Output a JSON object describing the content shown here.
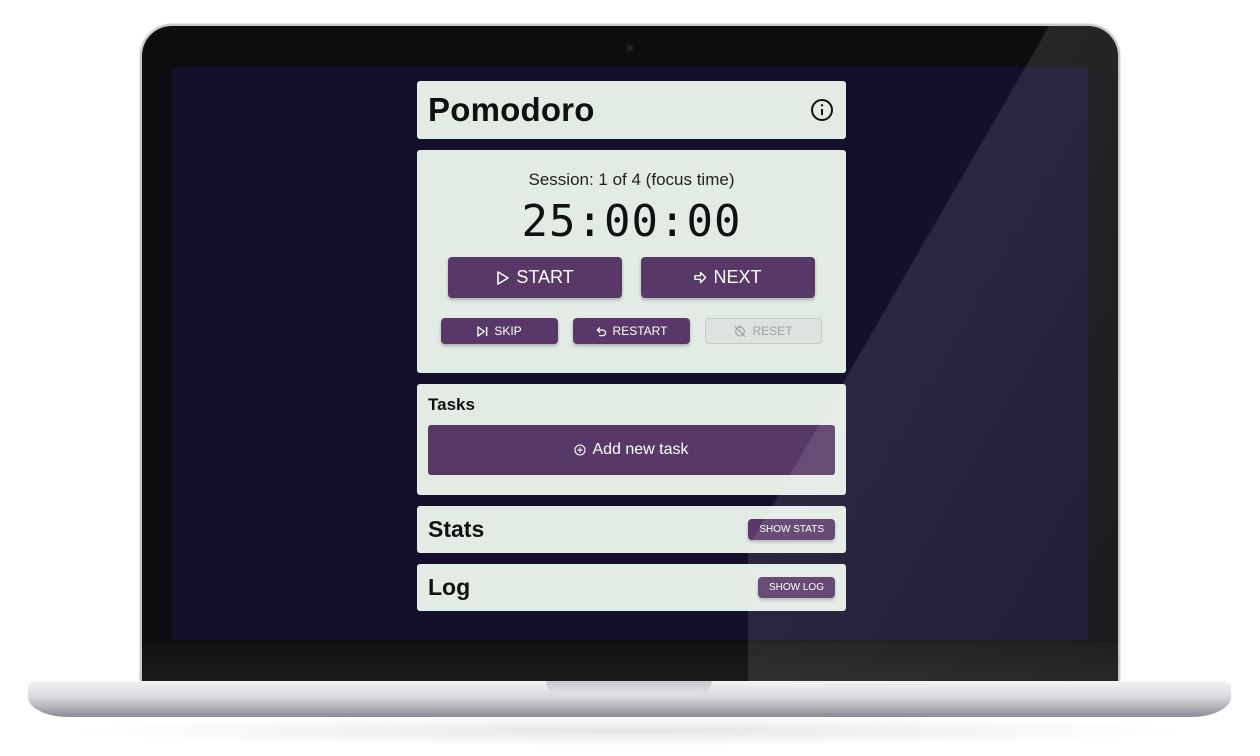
{
  "app": {
    "title": "Pomodoro",
    "info_icon": "info-icon"
  },
  "timer": {
    "session_text": "Session: 1 of 4 (focus time)",
    "clock": "25:00:00",
    "start_label": "START",
    "start_icon": "play-icon",
    "next_label": "NEXT",
    "next_icon": "arrow-right-icon",
    "skip_label": "SKIP",
    "skip_icon": "skip-icon",
    "restart_label": "RESTART",
    "restart_icon": "undo-icon",
    "reset_label": "RESET",
    "reset_icon": "timer-off-icon",
    "reset_disabled": true
  },
  "tasks": {
    "heading": "Tasks",
    "add_label": "Add new task",
    "add_icon": "plus-circle-icon"
  },
  "stats": {
    "heading": "Stats",
    "button_label": "SHOW STATS"
  },
  "log": {
    "heading": "Log",
    "button_label": "SHOW LOG"
  },
  "colors": {
    "screen_bg": "#140f2b",
    "card_bg": "#e3ebe5",
    "accent": "#573866",
    "disabled_bg": "#dde3de"
  }
}
